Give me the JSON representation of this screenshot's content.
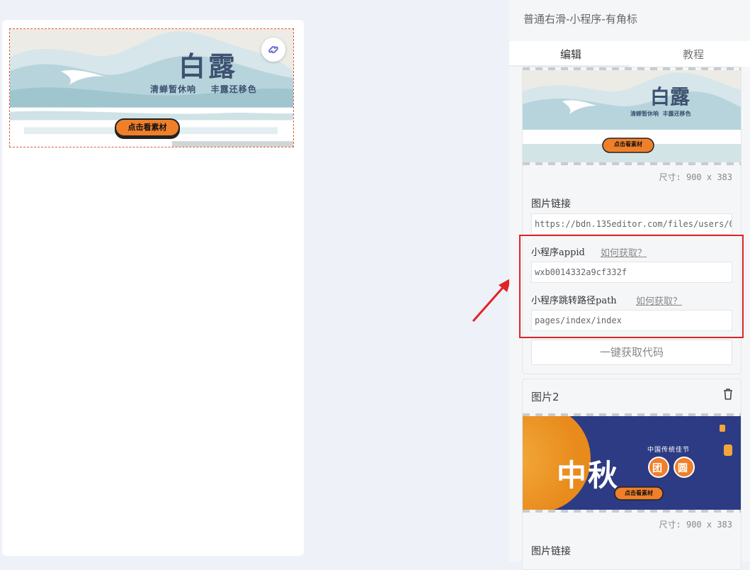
{
  "preview": {
    "banner": {
      "title": "白露",
      "subtitle": "清蝉暂休响    丰露还移色",
      "button_label": "点击看素材"
    }
  },
  "panel": {
    "header_title": "普通右滑-小程序-有角标",
    "tabs": [
      {
        "label": "编辑",
        "active": true
      },
      {
        "label": "教程",
        "active": false
      }
    ],
    "image1": {
      "thumb_title": "白露",
      "thumb_subtitle": "清蝉暂休响  丰露还移色",
      "thumb_button": "点击看素材",
      "size_text": "尺寸: 900 x 383",
      "link_label": "图片链接",
      "link_value": "https://bdn.135editor.com/files/users/0/",
      "appid_label": "小程序appid",
      "appid_howto": "如何获取？",
      "appid_value": "wxb0014332a9cf332f",
      "path_label": "小程序跳转路径path",
      "path_howto": "如何获取？",
      "path_value": "pages/index/index",
      "code_button": "一键获取代码"
    },
    "image2": {
      "title": "图片2",
      "thumb_title": "中秋",
      "thumb_badges": [
        "团",
        "圆"
      ],
      "thumb_subtitle": "中国传统佳节",
      "thumb_button": "点击看素材",
      "size_text": "尺寸: 900 x 383",
      "link_label": "图片链接"
    }
  },
  "colors": {
    "highlight_box": "#e02424",
    "arrow": "#e02424",
    "banner_button": "#f07f2a"
  }
}
